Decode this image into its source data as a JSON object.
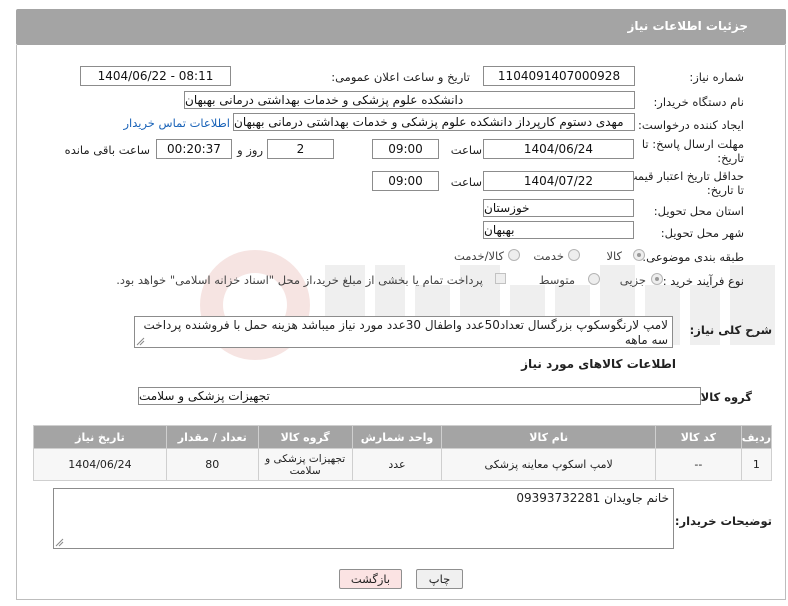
{
  "header": {
    "title": "جزئیات اطلاعات نیاز"
  },
  "form": {
    "need_number_label": "شماره نیاز:",
    "need_number": "1104091407000928",
    "announce_label": "تاریخ و ساعت اعلان عمومی:",
    "announce_value": "1404/06/22 - 08:11",
    "buyer_org_label": "نام دستگاه خریدار:",
    "buyer_org": "دانشکده علوم پزشکی و خدمات بهداشتی  درمانی بهبهان",
    "requester_label": "ایجاد کننده درخواست:",
    "requester": "مهدی دستوم کارپرداز دانشکده علوم پزشکی و خدمات بهداشتی  درمانی بهبهان",
    "contact_link": "اطلاعات تماس خریدار",
    "deadline_label_1": "مهلت ارسال پاسخ: تا",
    "deadline_label_2": "تاریخ:",
    "deadline_date": "1404/06/24",
    "time_label": "ساعت",
    "deadline_time": "09:00",
    "days_value": "2",
    "days_label": "روز و",
    "remaining_value": "00:20:37",
    "remaining_label": "ساعت باقی مانده",
    "price_validity_label_1": "حداقل تاریخ اعتبار قیمت:",
    "price_validity_label_2": "تا تاریخ:",
    "price_validity_date": "1404/07/22",
    "price_validity_time": "09:00",
    "province_label": "استان محل تحویل:",
    "province": "خوزستان",
    "city_label": "شهر محل تحویل:",
    "city": "بهبهان",
    "category_label": "طبقه بندی موضوعی:",
    "category_options": [
      "کالا",
      "خدمت",
      "کالا/خدمت"
    ],
    "category_selected": "کالا",
    "process_label": "نوع فرآیند خرید :",
    "process_options": [
      "جزیی",
      "متوسط"
    ],
    "process_note": "پرداخت تمام یا بخشی از مبلغ خرید،از محل \"اسناد خزانه اسلامی\" خواهد بود.",
    "description_label": "شرح کلی نیاز:",
    "description": "لامپ لارنگوسکوپ بزرگسال تعداد50عدد واطفال 30عدد مورد نیاز میباشد هزینه حمل با فروشنده پرداخت سه ماهه",
    "goods_info_title": "اطلاعات کالاهای مورد نیاز",
    "goods_group_label": "گروه کالا:",
    "goods_group": "تجهیزات پزشکی و سلامت",
    "buyer_notes_label": "توضیحات خریدار:",
    "buyer_notes": "خانم جاویدان 09393732281"
  },
  "table": {
    "columns": [
      "ردیف",
      "کد کالا",
      "نام کالا",
      "واحد شمارش",
      "گروه کالا",
      "تعداد / مقدار",
      "تاریخ نیاز"
    ],
    "rows": [
      [
        "1",
        "--",
        "لامپ اسکوپ معاینه پزشکی",
        "عدد",
        "تجهیزات پزشکی و سلامت",
        "80",
        "1404/06/24"
      ]
    ]
  },
  "buttons": {
    "print": "چاپ",
    "back": "بازگشت"
  },
  "colors": {
    "header_bg": "#a4a4a4",
    "link": "#1a63b8",
    "back_button_bg": "#fbe3e3"
  }
}
